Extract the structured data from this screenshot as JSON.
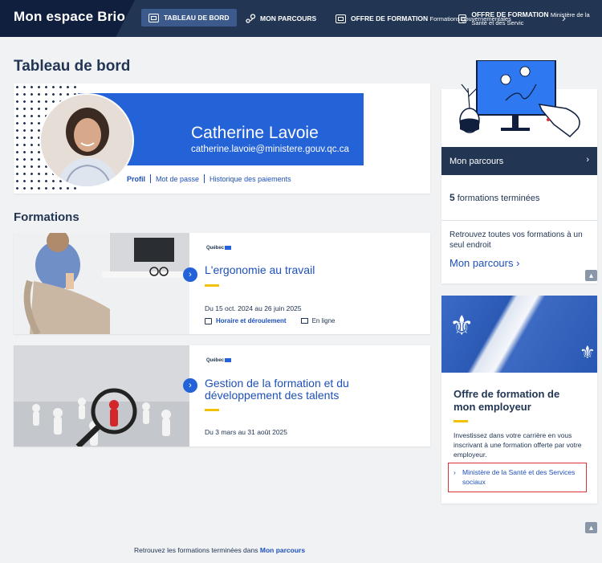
{
  "header": {
    "brand": "Mon espace Brio",
    "nav": [
      {
        "label": "TABLEAU DE BORD",
        "icon": "dashboard-icon"
      },
      {
        "label": "MON PARCOURS",
        "icon": "route-icon"
      },
      {
        "label": "OFFRE DE FORMATION",
        "sub": "Formations gouvernementales",
        "icon": "screen-icon"
      },
      {
        "label": "OFFRE DE FORMATION",
        "sub": "Ministère de la Santé et des Servic",
        "icon": "screen-icon"
      }
    ]
  },
  "page_title": "Tableau de bord",
  "profile": {
    "name": "Catherine Lavoie",
    "email": "catherine.lavoie@ministere.gouv.qc.ca",
    "links": [
      "Profil",
      "Mot de passe",
      "Historique des paiements"
    ]
  },
  "formations_title": "Formations",
  "courses": [
    {
      "brand": "Québec",
      "title": "L'ergonomie au travail",
      "dates": "Du 15 oct. 2024 au 26 juin 2025",
      "schedule_link": "Horaire et déroulement",
      "mode": "En ligne"
    },
    {
      "brand": "Québec",
      "title": "Gestion de la formation et du développement des talents",
      "dates": "Du 3 mars au 31 août 2025"
    }
  ],
  "parcours_card": {
    "heading": "Mon parcours",
    "count": "5",
    "count_label": "formations terminées",
    "find_text": "Retrouvez toutes vos formations à un seul endroit",
    "link": "Mon parcours"
  },
  "employer_card": {
    "title": "Offre de formation de mon employeur",
    "text": "Investissez dans votre carrière en vous inscrivant à une formation offerte par votre employeur.",
    "link": "Ministère de la Santé et des Services sociaux"
  },
  "footer": {
    "text": "Retrouvez les formations terminées dans",
    "link": "Mon parcours"
  },
  "colors": {
    "navy": "#223654",
    "blue": "#2462d8",
    "link": "#1e50b9",
    "yellow": "#f2c200",
    "highlight": "#d9303a"
  }
}
